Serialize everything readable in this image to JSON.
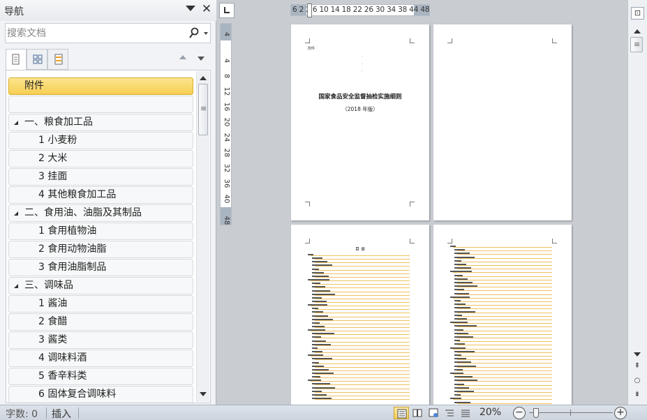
{
  "nav": {
    "title": "导航",
    "search_placeholder": "搜索文档",
    "tabs": [
      "headings",
      "pages",
      "results"
    ],
    "items": [
      {
        "label": "附件",
        "level": 0,
        "selected": true,
        "expandable": false
      },
      {
        "label": "",
        "level": 0,
        "selected": false,
        "expandable": false
      },
      {
        "label": "一、粮食加工品",
        "level": 0,
        "selected": false,
        "expandable": true
      },
      {
        "label": "1 小麦粉",
        "level": 1,
        "selected": false,
        "expandable": false
      },
      {
        "label": "2 大米",
        "level": 1,
        "selected": false,
        "expandable": false
      },
      {
        "label": "3 挂面",
        "level": 1,
        "selected": false,
        "expandable": false
      },
      {
        "label": "4 其他粮食加工品",
        "level": 1,
        "selected": false,
        "expandable": false
      },
      {
        "label": "二、食用油、油脂及其制品",
        "level": 0,
        "selected": false,
        "expandable": true
      },
      {
        "label": "1 食用植物油",
        "level": 1,
        "selected": false,
        "expandable": false
      },
      {
        "label": "2 食用动物油脂",
        "level": 1,
        "selected": false,
        "expandable": false
      },
      {
        "label": "3 食用油脂制品",
        "level": 1,
        "selected": false,
        "expandable": false
      },
      {
        "label": "三、调味品",
        "level": 0,
        "selected": false,
        "expandable": true
      },
      {
        "label": "1 酱油",
        "level": 1,
        "selected": false,
        "expandable": false
      },
      {
        "label": "2 食醋",
        "level": 1,
        "selected": false,
        "expandable": false
      },
      {
        "label": "3 酱类",
        "level": 1,
        "selected": false,
        "expandable": false
      },
      {
        "label": "4 调味料酒",
        "level": 1,
        "selected": false,
        "expandable": false
      },
      {
        "label": "5 香辛料类",
        "level": 1,
        "selected": false,
        "expandable": false
      },
      {
        "label": "6 固体复合调味料",
        "level": 1,
        "selected": false,
        "expandable": false
      }
    ]
  },
  "ruler": {
    "horizontal_ticks": "6  2  2  6  10 14 18 22 26 30 34 38  44 48",
    "vertical_ticks": [
      "4",
      "4",
      "8",
      "12",
      "16",
      "20",
      "24",
      "28",
      "32",
      "36",
      "40",
      "48"
    ]
  },
  "document": {
    "page1_label": "附件",
    "title": "国家食品安全监督抽检实施细则",
    "subtitle": "（2018 年版）",
    "toc_heading": "目  录"
  },
  "statusbar": {
    "word_count": "字数: 0",
    "insert_mode": "插入",
    "zoom": "20%",
    "zoom_level_fraction": 0.2
  },
  "colors": {
    "selected_item": "#f6cf52",
    "toc_leader": "#f0c060",
    "canvas": "#c9cdd2"
  }
}
